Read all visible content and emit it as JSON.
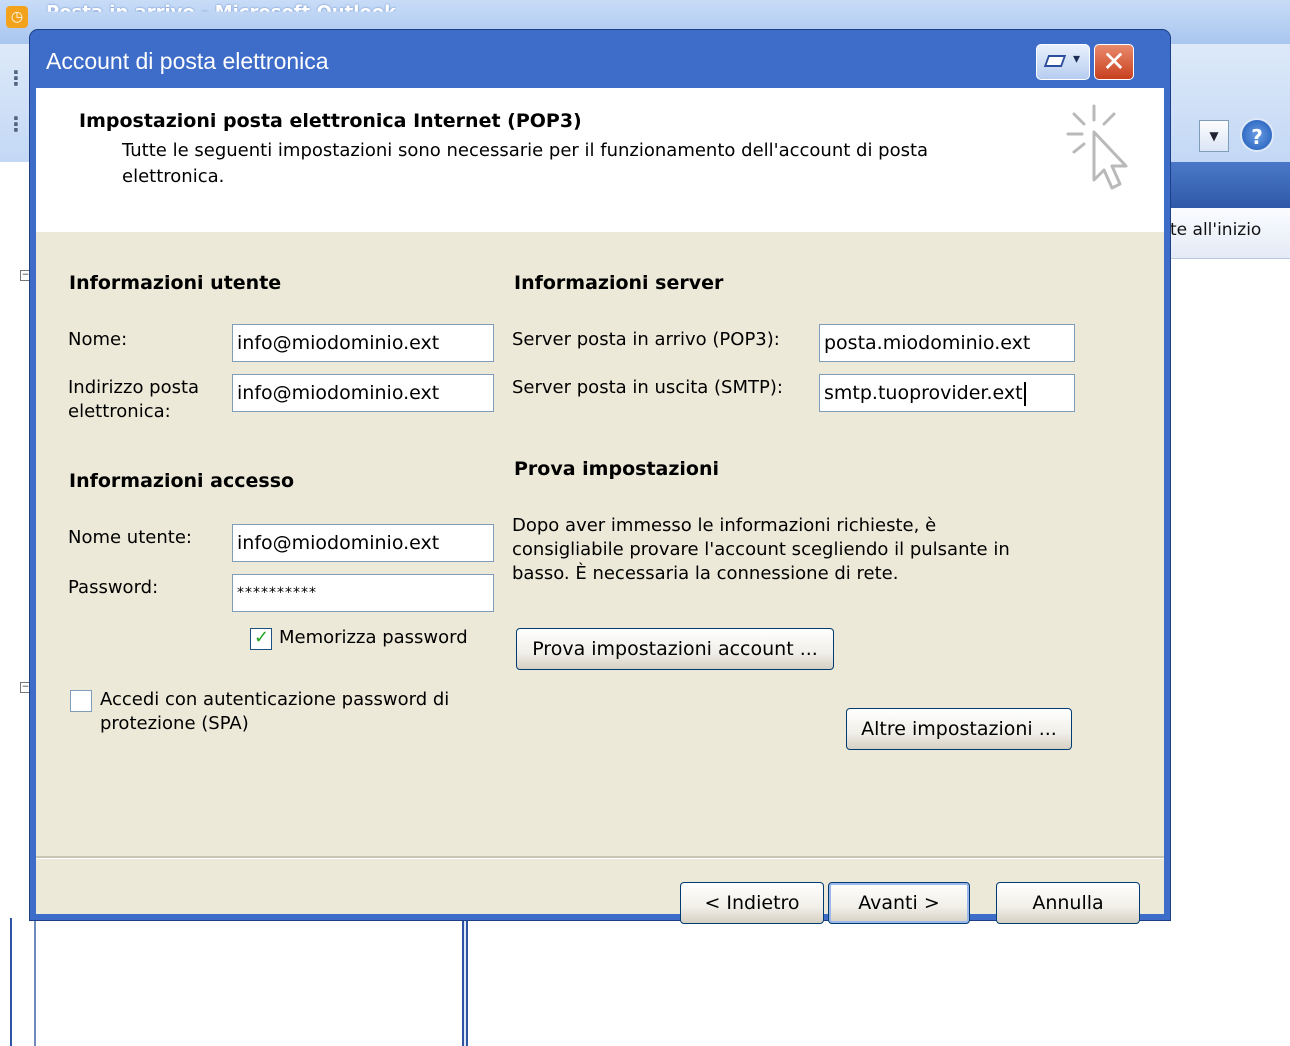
{
  "background": {
    "window_title": "Posta in arrivo - Microsoft Outlook",
    "column_header": "te all'inizio"
  },
  "dialog": {
    "title": "Account di posta elettronica",
    "header": {
      "title": "Impostazioni posta elettronica Internet (POP3)",
      "description": "Tutte le seguenti impostazioni sono necessarie per il funzionamento dell'account di posta elettronica."
    },
    "user_info": {
      "heading": "Informazioni utente",
      "name_label": "Nome:",
      "name_value": "info@miodominio.ext",
      "email_label": "Indirizzo posta elettronica:",
      "email_value": "info@miodominio.ext"
    },
    "server_info": {
      "heading": "Informazioni server",
      "incoming_label": "Server posta in arrivo (POP3):",
      "incoming_value": "posta.miodominio.ext",
      "outgoing_label": "Server posta in uscita (SMTP):",
      "outgoing_value": "smtp.tuoprovider.ext"
    },
    "login_info": {
      "heading": "Informazioni accesso",
      "username_label": "Nome utente:",
      "username_value": "info@miodominio.ext",
      "password_label": "Password:",
      "password_value": "**********",
      "remember_label": "Memorizza password",
      "remember_checked": true,
      "spa_label": "Accedi con autenticazione password di protezione (SPA)",
      "spa_checked": false
    },
    "test": {
      "heading": "Prova impostazioni",
      "description": "Dopo aver immesso le informazioni richieste, è consigliabile provare l'account scegliendo il pulsante in basso. È necessaria la connessione di rete.",
      "test_button": "Prova impostazioni account ...",
      "more_button": "Altre impostazioni ..."
    },
    "footer": {
      "back": "< Indietro",
      "next": "Avanti >",
      "cancel": "Annulla"
    }
  },
  "colors": {
    "dialog_frame": "#3d6cc9",
    "body_bg": "#ece9d8",
    "close_button": "#c8401f"
  }
}
